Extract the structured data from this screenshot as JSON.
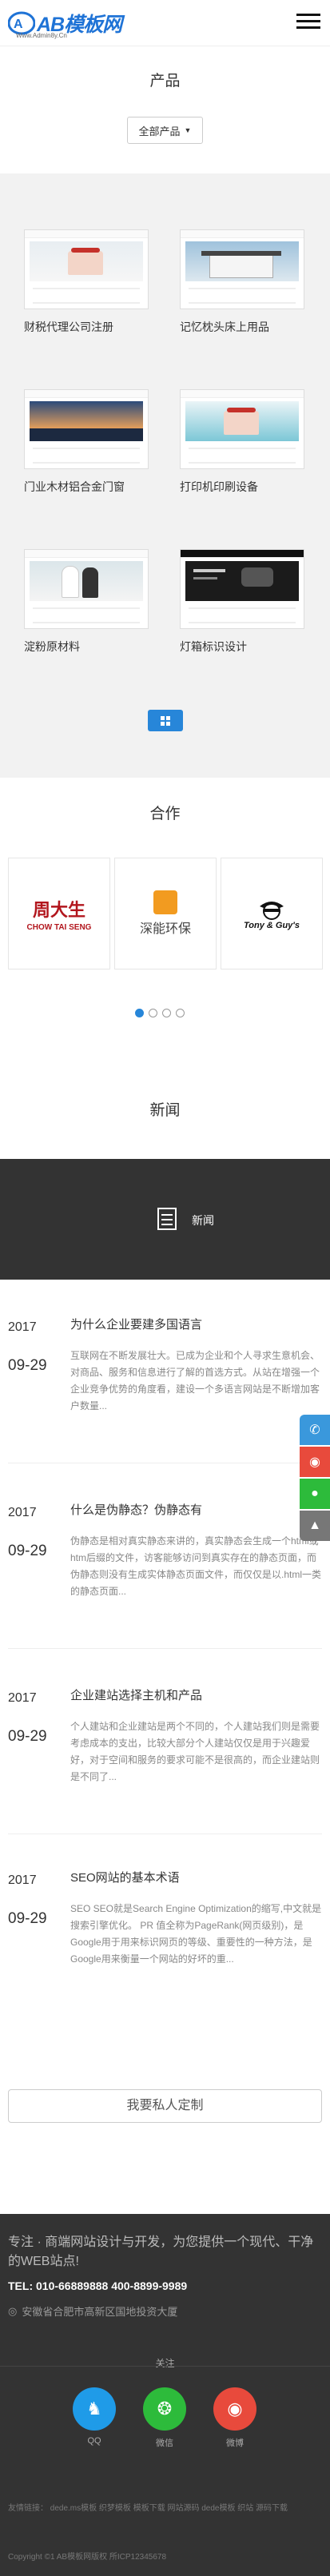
{
  "header": {
    "logo_text": "AB模板网",
    "logo_sub": "Www.Admin8y.Cn"
  },
  "products": {
    "title": "产品",
    "filter_label": "全部产品",
    "items": [
      {
        "label": "财税代理公司注册"
      },
      {
        "label": "记忆枕头床上用品"
      },
      {
        "label": "门业木材铝合金门窗"
      },
      {
        "label": "打印机印刷设备"
      },
      {
        "label": "淀粉原材料"
      },
      {
        "label": "灯箱标识设计"
      }
    ]
  },
  "partners": {
    "title": "合作",
    "items": [
      {
        "name": "周大生",
        "sub": "CHOW TAI SENG"
      },
      {
        "name": "深能环保",
        "sub": ""
      },
      {
        "name": "Tony & Guy's",
        "sub": ""
      }
    ]
  },
  "news": {
    "title": "新闻",
    "banner_label": "新闻",
    "items": [
      {
        "year": "2017",
        "date": "09-29",
        "title": "为什么企业要建多国语言",
        "body": "互联网在不断发展壮大。已成为企业和个人寻求生意机会、对商品、服务和信息进行了解的首选方式。从站在增强一个企业竞争优势的角度看，建设一个多语言网站是不断增加客户数量..."
      },
      {
        "year": "2017",
        "date": "09-29",
        "title": "什么是伪静态？伪静态有",
        "body": "伪静态是相对真实静态来讲的，真实静态会生成一个html或htm后缀的文件，访客能够访问到真实存在的静态页面，而伪静态则没有生成实体静态页面文件，而仅仅是以.html一类的静态页面..."
      },
      {
        "year": "2017",
        "date": "09-29",
        "title": "企业建站选择主机和产品",
        "body": "个人建站和企业建站是两个不同的，个人建站我们则是需要考虑成本的支出，比较大部分个人建站仅仅是用于兴趣爱好，对于空间和服务的要求可能不是很高的，而企业建站则是不同了..."
      },
      {
        "year": "2017",
        "date": "09-29",
        "title": "SEO网站的基本术语",
        "body": "SEO SEO就是Search Engine Optimization的缩写,中文就是搜索引擎优化。 PR 值全称为PageRank(网页级别)，是Google用于用来标识网页的等级、重要性的一种方法，是Google用来衡量一个网站的好坏的重..."
      }
    ]
  },
  "custom_button": "我要私人定制",
  "footer": {
    "tagline": "专注 · 商端网站设计与开发，为您提供一个现代、干净的WEB站点!",
    "tel": "TEL: 010-66889888 400-8899-9989",
    "address": "安徽省合肥市高新区国地投资大厦",
    "follow": "关注",
    "socials": [
      {
        "label": "QQ",
        "color": "#1f9be8"
      },
      {
        "label": "微信",
        "color": "#2dbb3b"
      },
      {
        "label": "微博",
        "color": "#e84a3c"
      }
    ],
    "links": "友情链接：  dede.ms模板    织梦模板    模板下载    网站源码    dede模板    织站    源码下载",
    "copyright": "Copyright ©1 AB模板网版权 所ICP12345678"
  },
  "colors": {
    "accent": "#2786d9",
    "dark": "#333333"
  }
}
